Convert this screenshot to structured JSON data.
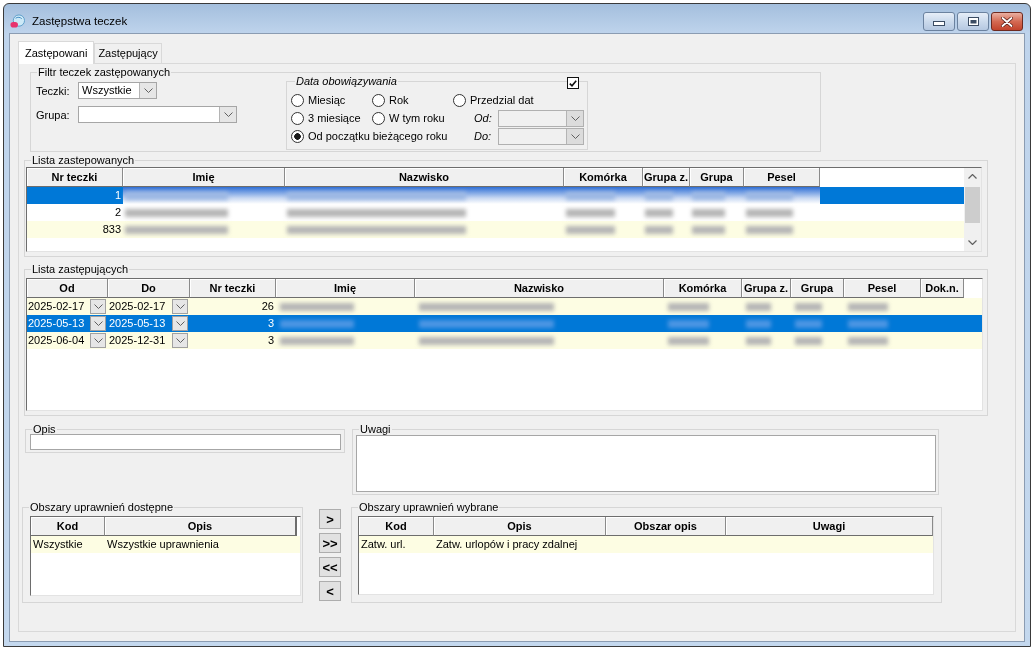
{
  "window": {
    "title": "Zastępstwa teczek"
  },
  "tabs": [
    {
      "label": "Zastępowani",
      "selected": true
    },
    {
      "label": "Zastępujący",
      "selected": false
    }
  ],
  "filter": {
    "title": "Filtr teczek zastępowanych",
    "fields": [
      {
        "label": "Teczki:",
        "value": "Wszystkie"
      },
      {
        "label": "Grupa:"
      }
    ],
    "date_range": {
      "title": "Data obowiązywania",
      "checked": true,
      "options": [
        {
          "label": "Miesiąc",
          "selected": false
        },
        {
          "label": "Rok",
          "selected": false
        },
        {
          "label": "Przedzial dat",
          "selected": false
        },
        {
          "label": "3 miesiące",
          "selected": false
        },
        {
          "label": "W tym roku",
          "selected": false
        },
        {
          "label": "Od początku bieżącego roku",
          "selected": true
        }
      ],
      "date_fields": [
        {
          "label": "Od:",
          "disabled": true
        },
        {
          "label": "Do:",
          "disabled": true
        }
      ]
    }
  },
  "replaced_list": {
    "title": "Lista zastepowanych",
    "columns": [
      {
        "label": "Nr teczki",
        "kind": "number"
      },
      {
        "label": "Imię",
        "kind": "blurred"
      },
      {
        "label": "Nazwisko",
        "kind": "blurred"
      },
      {
        "label": "Komórka",
        "kind": "blurred"
      },
      {
        "label": "Grupa z.",
        "kind": "blurred"
      },
      {
        "label": "Grupa",
        "kind": "blurred"
      },
      {
        "label": "Pesel",
        "kind": "blurred"
      }
    ],
    "rows": [
      {
        "selected": true,
        "cells": [
          "1"
        ]
      },
      {
        "selected": false,
        "cells": [
          "2"
        ]
      },
      {
        "selected": false,
        "cells": [
          "833"
        ]
      }
    ]
  },
  "substitutes_list": {
    "title": "Lista zastępujących",
    "columns": [
      {
        "label": "Od",
        "kind": "date"
      },
      {
        "label": "Do",
        "kind": "date"
      },
      {
        "label": "Nr teczki",
        "kind": "number"
      },
      {
        "label": "Imię",
        "kind": "blurred"
      },
      {
        "label": "Nazwisko",
        "kind": "blurred"
      },
      {
        "label": "Komórka",
        "kind": "blurred"
      },
      {
        "label": "Grupa z.",
        "kind": "blurred"
      },
      {
        "label": "Grupa",
        "kind": "blurred"
      },
      {
        "label": "Pesel",
        "kind": "blurred"
      },
      {
        "label": "Dok.n.",
        "kind": "text"
      }
    ],
    "rows": [
      {
        "selected": false,
        "cells": [
          "2025-02-17",
          "2025-02-17",
          "26"
        ]
      },
      {
        "selected": true,
        "cells": [
          "2025-05-13",
          "2025-05-13",
          "3"
        ]
      },
      {
        "selected": false,
        "cells": [
          "2025-06-04",
          "2025-12-31",
          "3"
        ]
      }
    ]
  },
  "description": {
    "label": "Opis"
  },
  "notes": {
    "label": "Uwagi"
  },
  "available_areas": {
    "title": "Obszary uprawnień dostępne",
    "columns": [
      {
        "label": "Kod"
      },
      {
        "label": "Opis"
      }
    ],
    "rows": [
      {
        "selected": false,
        "cells": [
          "Wszystkie",
          "Wszystkie uprawnienia"
        ]
      }
    ]
  },
  "transfer_buttons": [
    ">",
    ">>",
    "<<",
    "<"
  ],
  "selected_areas": {
    "title": "Obszary uprawnień wybrane",
    "columns": [
      {
        "label": "Kod"
      },
      {
        "label": "Opis"
      },
      {
        "label": "Obszar opis"
      },
      {
        "label": "Uwagi"
      }
    ],
    "rows": [
      {
        "selected": false,
        "cells": [
          "Zatw. url.",
          "Zatw. urlopów i pracy zdalnej"
        ]
      }
    ]
  }
}
